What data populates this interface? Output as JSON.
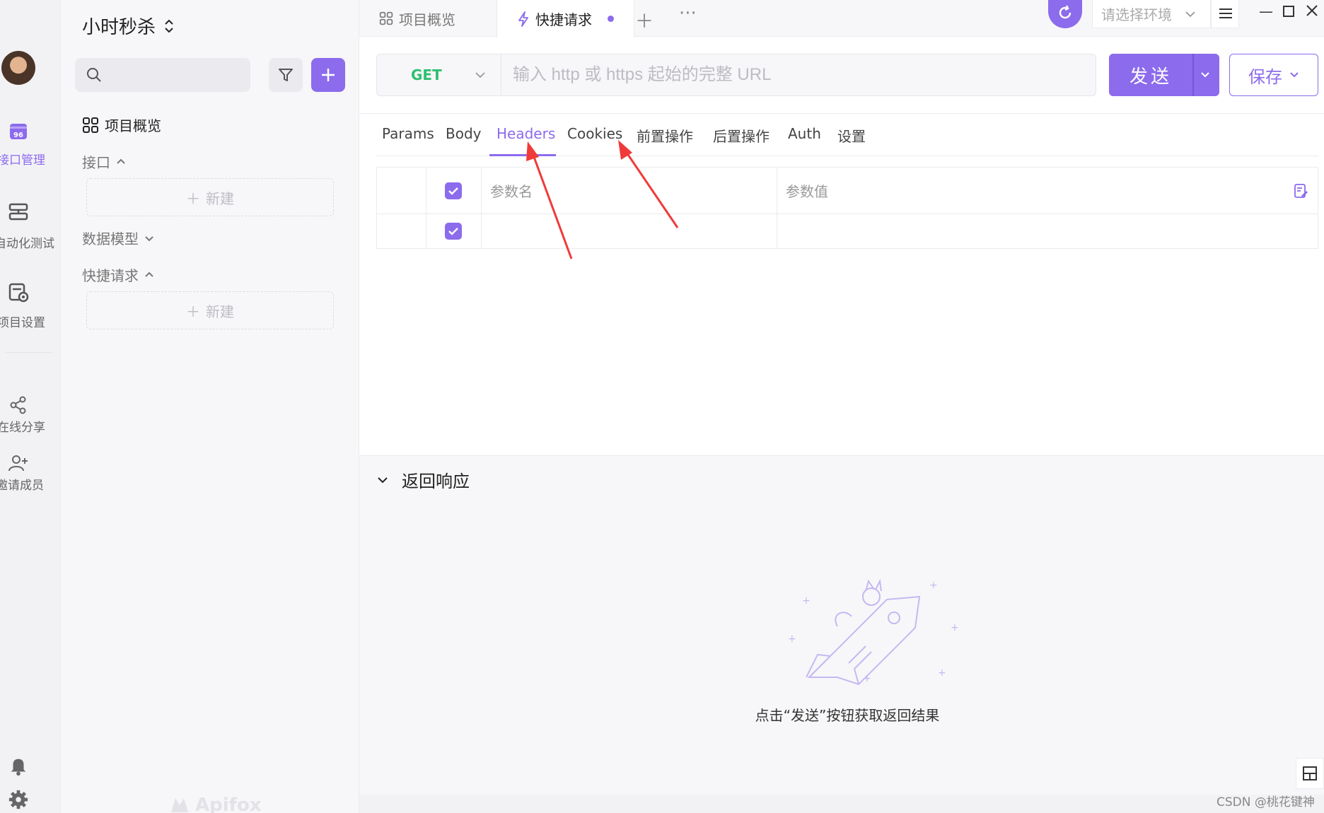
{
  "rail": {
    "items": [
      {
        "label": "接口管理",
        "icon": "api-management-icon",
        "active": true
      },
      {
        "label": "自动化测试",
        "icon": "automation-test-icon"
      },
      {
        "label": "项目设置",
        "icon": "project-settings-icon"
      },
      {
        "label": "在线分享",
        "icon": "share-icon"
      },
      {
        "label": "邀请成员",
        "icon": "invite-member-icon"
      }
    ]
  },
  "sidebar": {
    "project_title": "小时秒杀",
    "overview_label": "项目概览",
    "sections": [
      {
        "label": "接口",
        "expanded": true,
        "new_label": "新建"
      },
      {
        "label": "数据模型",
        "expanded": false
      },
      {
        "label": "快捷请求",
        "expanded": true,
        "new_label": "新建"
      }
    ],
    "brand": "Apifox"
  },
  "tabs": [
    {
      "label": "项目概览",
      "icon": "grid-icon"
    },
    {
      "label": "快捷请求",
      "icon": "lightning-icon",
      "active": true,
      "unsaved": true
    }
  ],
  "topbar": {
    "env_placeholder": "请选择环境"
  },
  "request": {
    "method": "GET",
    "url_placeholder": "输入 http 或 https 起始的完整 URL",
    "send_label": "发送",
    "save_label": "保存"
  },
  "request_tabs": [
    "Params",
    "Body",
    "Headers",
    "Cookies",
    "前置操作",
    "后置操作",
    "Auth",
    "设置"
  ],
  "active_request_tab": "Headers",
  "params_table": {
    "name_header": "参数名",
    "value_header": "参数值"
  },
  "response": {
    "title": "返回响应",
    "hint": "点击“发送”按钮获取返回结果"
  },
  "watermark": "CSDN @桃花键神",
  "colors": {
    "accent": "#8c6bec",
    "method_get": "#2fbf71",
    "annotation_arrow": "#f03a3a"
  }
}
